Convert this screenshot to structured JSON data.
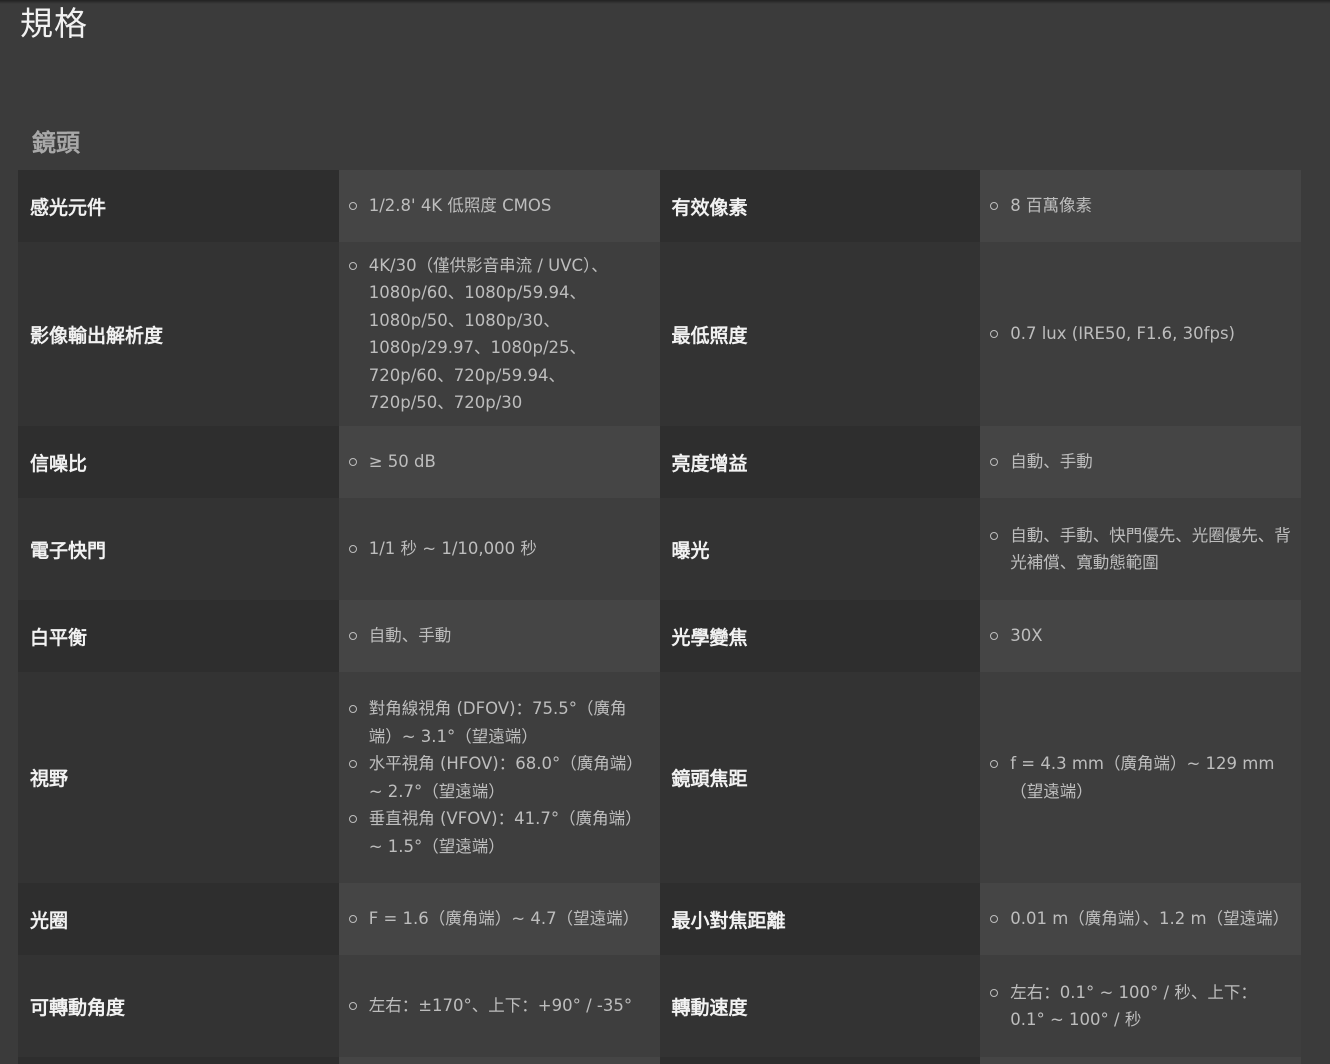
{
  "page": {
    "title": "規格"
  },
  "section": {
    "title": "鏡頭"
  },
  "rows": [
    {
      "left_label": "感光元件",
      "left_values": [
        "1/2.8' 4K 低照度 CMOS"
      ],
      "right_label": "有效像素",
      "right_values": [
        "8 百萬像素"
      ]
    },
    {
      "left_label": "影像輸出解析度",
      "left_values": [
        "4K/30（僅供影音串流 / UVC）、1080p/60、1080p/59.94、1080p/50、1080p/30、1080p/29.97、1080p/25、720p/60、720p/59.94、720p/50、720p/30"
      ],
      "right_label": "最低照度",
      "right_values": [
        "0.7 lux (IRE50, F1.6, 30fps)"
      ]
    },
    {
      "left_label": "信噪比",
      "left_values": [
        "≥ 50 dB"
      ],
      "right_label": "亮度增益",
      "right_values": [
        "自動、手動"
      ]
    },
    {
      "left_label": "電子快門",
      "left_values": [
        "1/1 秒 ~ 1/10,000 秒"
      ],
      "right_label": "曝光",
      "right_values": [
        "自動、手動、快門優先、光圈優先、背光補償、寬動態範圍"
      ]
    },
    {
      "left_label": "白平衡",
      "left_values": [
        "自動、手動"
      ],
      "right_label": "光學變焦",
      "right_values": [
        "30X"
      ]
    },
    {
      "left_label": "視野",
      "left_values": [
        "對角線視角 (DFOV)：75.5°（廣角端）~ 3.1°（望遠端）",
        "水平視角 (HFOV)：68.0°（廣角端）~ 2.7°（望遠端）",
        "垂直視角 (VFOV)：41.7°（廣角端）~ 1.5°（望遠端）"
      ],
      "right_label": "鏡頭焦距",
      "right_values": [
        "f = 4.3 mm（廣角端）~ 129 mm（望遠端）"
      ]
    },
    {
      "left_label": "光圈",
      "left_values": [
        "F = 1.6（廣角端）~ 4.7（望遠端）"
      ],
      "right_label": "最小對焦距離",
      "right_values": [
        "0.01 m（廣角端）、1.2 m（望遠端）"
      ]
    },
    {
      "left_label": "可轉動角度",
      "left_values": [
        "左右：±170°、上下：+90° / -35°"
      ],
      "right_label": "轉動速度",
      "right_values": [
        "左右：0.1° ~ 100° / 秒、上下：0.1° ~ 100° / 秒"
      ]
    }
  ]
}
